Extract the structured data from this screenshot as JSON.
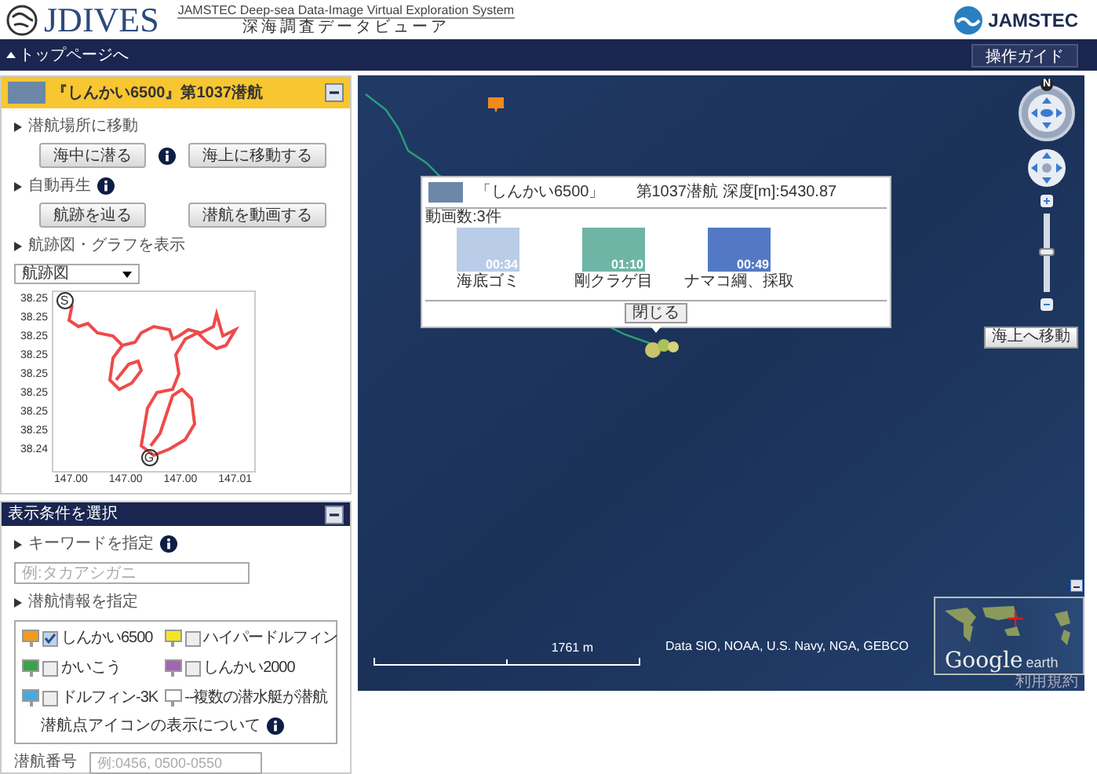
{
  "header": {
    "logo_text": "JDIVES",
    "subtitle_en": "JAMSTEC Deep-sea Data-Image Virtual Exploration System",
    "subtitle_ja": "深海調査データビューア",
    "org": "JAMSTEC"
  },
  "nav": {
    "back": "トップページへ",
    "guide": "操作ガイド"
  },
  "dive_panel": {
    "title": "『しんかい6500』第1037潜航",
    "sections": [
      {
        "label": "潜航場所に移動",
        "info": false,
        "buttons": [
          "海中に潜る",
          "海上に移動する"
        ],
        "button_info": true
      },
      {
        "label": "自動再生",
        "info": true,
        "buttons": [
          "航跡を辿る",
          "潜航を動画する"
        ],
        "button_info": false
      }
    ],
    "chart_label": "航跡図・グラフを表示",
    "select_value": "航跡図",
    "track_chart": {
      "y_labels": [
        "38.25",
        "38.25",
        "38.25",
        "38.25",
        "38.25",
        "38.25",
        "38.25",
        "38.25",
        "38.24"
      ],
      "x_labels": [
        "147.00",
        "147.00",
        "147.00",
        "147.01"
      ],
      "start": "S",
      "goal": "G"
    }
  },
  "condition_panel": {
    "title": "表示条件を選択",
    "keyword_label": "キーワードを指定",
    "keyword_placeholder": "例:タカアシガニ",
    "info_label": "潜航情報を指定",
    "vessels": [
      {
        "kind": "vessel",
        "label": "しんかい6500",
        "color": "#f39a1e",
        "checked": true
      },
      {
        "kind": "vessel",
        "label": "ハイパードルフィン",
        "color": "#f5e61e",
        "checked": false
      },
      {
        "kind": "vessel",
        "label": "かいこう",
        "color": "#3aa34a",
        "checked": false
      },
      {
        "kind": "vessel",
        "label": "しんかい2000",
        "color": "#a463b5",
        "checked": false
      },
      {
        "kind": "vessel",
        "label": "ドルフィン-3K",
        "color": "#4aa8e0",
        "checked": false
      },
      {
        "kind": "legend",
        "label": "--複数の潜水艇が潜航",
        "color": "#ffffff"
      }
    ],
    "icon_note": "潜航点アイコンの表示について",
    "dive_number_label": "潜航番号",
    "dive_number_placeholder": "例:0456, 0500-0550"
  },
  "map": {
    "popup": {
      "vessel": "「しんかい6500」",
      "dive": "第1037潜航 深度[m]:5430.87",
      "count": "動画数:3件",
      "videos": [
        {
          "duration": "00:34",
          "caption": "海底ゴミ"
        },
        {
          "duration": "01:10",
          "caption": "剛クラゲ目"
        },
        {
          "duration": "00:49",
          "caption": "ナマコ綱、採取"
        }
      ],
      "close": "閉じる"
    },
    "compass_label": "N",
    "zoom": {
      "level": 0.5
    },
    "surface_button": "海上へ移動",
    "scale": "1761 m",
    "attribution": "Data SIO, NOAA, U.S. Navy, NGA, GEBCO",
    "overview": {
      "brand_a": "Google",
      "brand_b": "earth",
      "terms": "利用規約"
    }
  }
}
